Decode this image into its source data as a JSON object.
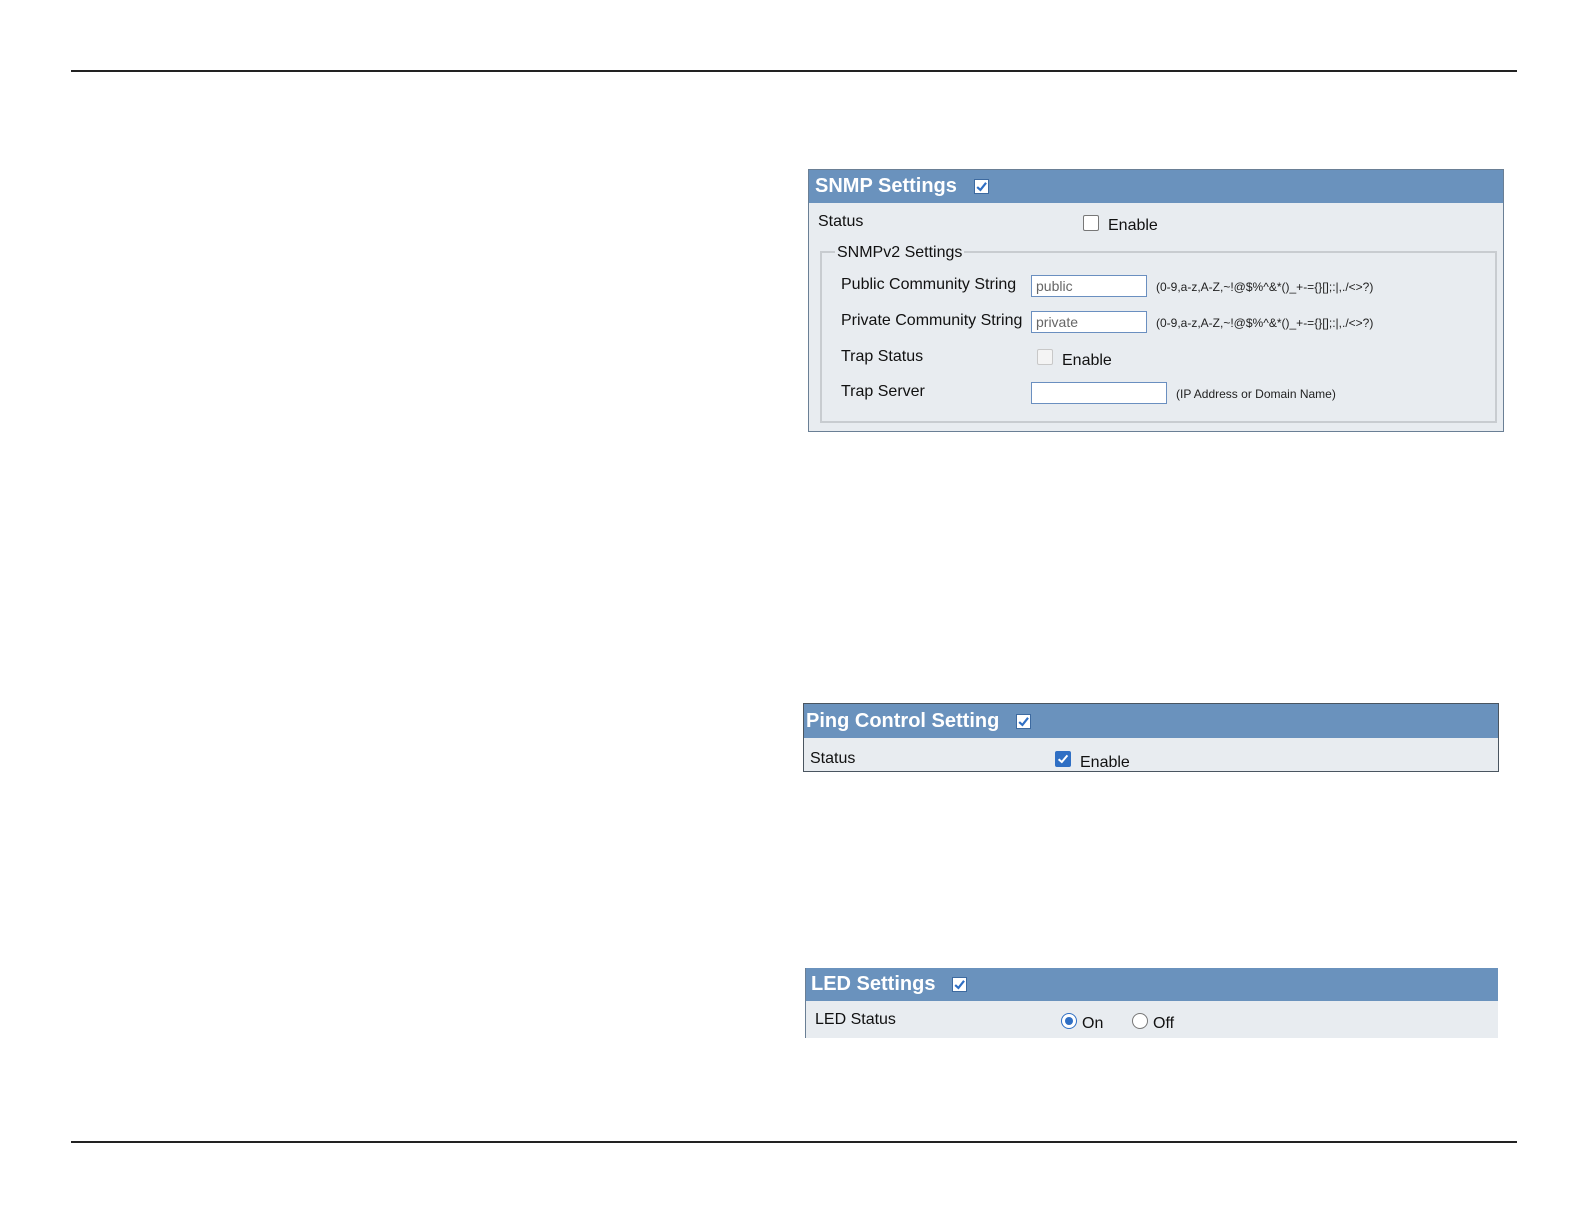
{
  "snmp": {
    "title": "SNMP Settings",
    "status_label": "Status",
    "status_enable_label": "Enable",
    "status_enabled": false,
    "snmpv2": {
      "legend": "SNMPv2 Settings",
      "public_label": "Public Community String",
      "public_value": "public",
      "public_hint": "(0-9,a-z,A-Z,~!@$%^&*()_+-={}[];:|,./<>?)",
      "private_label": "Private Community String",
      "private_value": "private",
      "private_hint": "(0-9,a-z,A-Z,~!@$%^&*()_+-={}[];:|,./<>?)",
      "trap_status_label": "Trap Status",
      "trap_enable_label": "Enable",
      "trap_enabled": false,
      "trap_server_label": "Trap Server",
      "trap_server_value": "",
      "trap_server_hint": "(IP Address or Domain Name)"
    }
  },
  "ping": {
    "title": "Ping Control Setting",
    "status_label": "Status",
    "status_enable_label": "Enable",
    "status_enabled": true
  },
  "led": {
    "title": "LED Settings",
    "status_label": "LED Status",
    "options": [
      "On",
      "Off"
    ],
    "selected": "On"
  },
  "colors": {
    "header_bar": "#6a92bd",
    "panel_bg": "#e8ecf0",
    "check_blue": "#2f6fc4"
  }
}
